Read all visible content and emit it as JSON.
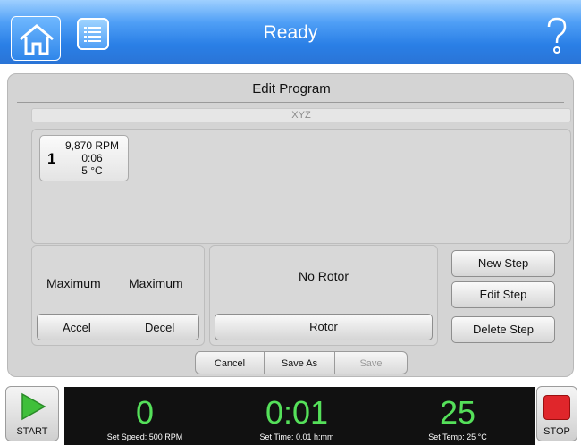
{
  "header": {
    "title": "Ready"
  },
  "panel": {
    "title": "Edit Program",
    "program_name": "XYZ",
    "steps": [
      {
        "number": "1",
        "speed": "9,870 RPM",
        "time": "0:06",
        "temp": "5 °C"
      }
    ],
    "accel_value": "Maximum",
    "decel_value": "Maximum",
    "accel_label": "Accel",
    "decel_label": "Decel",
    "rotor_status": "No Rotor",
    "rotor_label": "Rotor",
    "new_step": "New Step",
    "edit_step": "Edit Step",
    "delete_step": "Delete Step"
  },
  "bottom": {
    "cancel": "Cancel",
    "save_as": "Save As",
    "save": "Save"
  },
  "status": {
    "start_label": "START",
    "stop_label": "STOP",
    "speed_value": "0",
    "time_value": "0:01",
    "temp_value": "25",
    "set_speed": "Set Speed: 500 RPM",
    "set_time": "Set Time: 0.01 h:mm",
    "set_temp": "Set Temp: 25 °C"
  },
  "colors": {
    "header_blue": "#2a7fe6",
    "readout_green": "#55e05a",
    "stop_red": "#e0262b",
    "start_green": "#3fbf3a"
  }
}
